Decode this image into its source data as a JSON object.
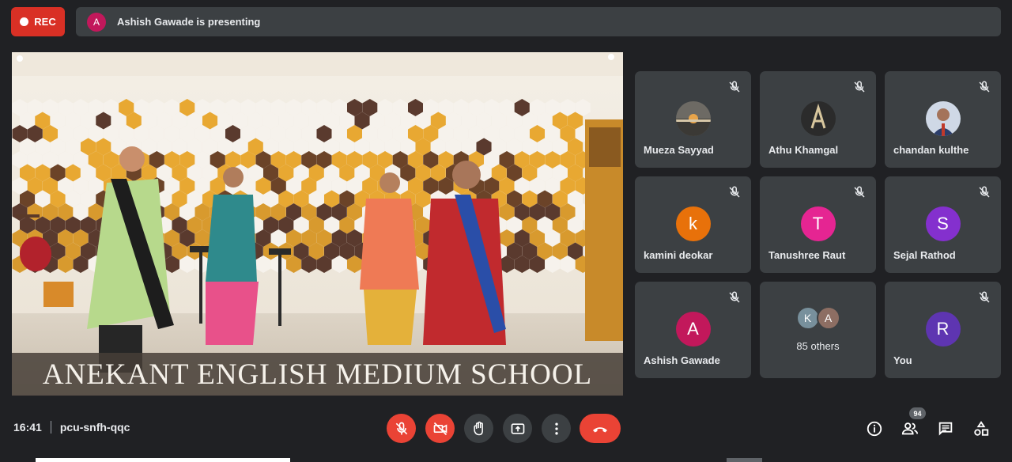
{
  "recording": {
    "label": "REC"
  },
  "presenter": {
    "initial": "A",
    "text": "Ashish Gawade is presenting"
  },
  "main_video": {
    "banner": "ANEKANT ENGLISH MEDIUM SCHOOL"
  },
  "participants": [
    {
      "name": "Mueza Sayyad",
      "avatar": "photo-sunset",
      "muted": true
    },
    {
      "name": "Athu Khamgal",
      "avatar": "photo-letter",
      "muted": true
    },
    {
      "name": "chandan kulthe",
      "avatar": "photo-person",
      "muted": true
    },
    {
      "name": "kamini deokar",
      "initial": "k",
      "color": "#e8710a",
      "muted": true
    },
    {
      "name": "Tanushree Raut",
      "initial": "T",
      "color": "#e52592",
      "muted": true
    },
    {
      "name": "Sejal Rathod",
      "initial": "S",
      "color": "#8430ce",
      "muted": true
    },
    {
      "name": "Ashish Gawade",
      "initial": "A",
      "color": "#c2185b",
      "muted": true
    },
    {
      "name": "You",
      "initial": "R",
      "color": "#5e35b1",
      "muted": true
    }
  ],
  "others": {
    "label": "85 others",
    "initials": [
      "K",
      "A"
    ],
    "colors": [
      "#78909c",
      "#8d6e63"
    ]
  },
  "meeting": {
    "time": "16:41",
    "code": "pcu-snfh-qqc"
  },
  "people_count": "94",
  "colors": {
    "danger": "#ea4335",
    "tile": "#3c4043",
    "background": "#202124"
  }
}
